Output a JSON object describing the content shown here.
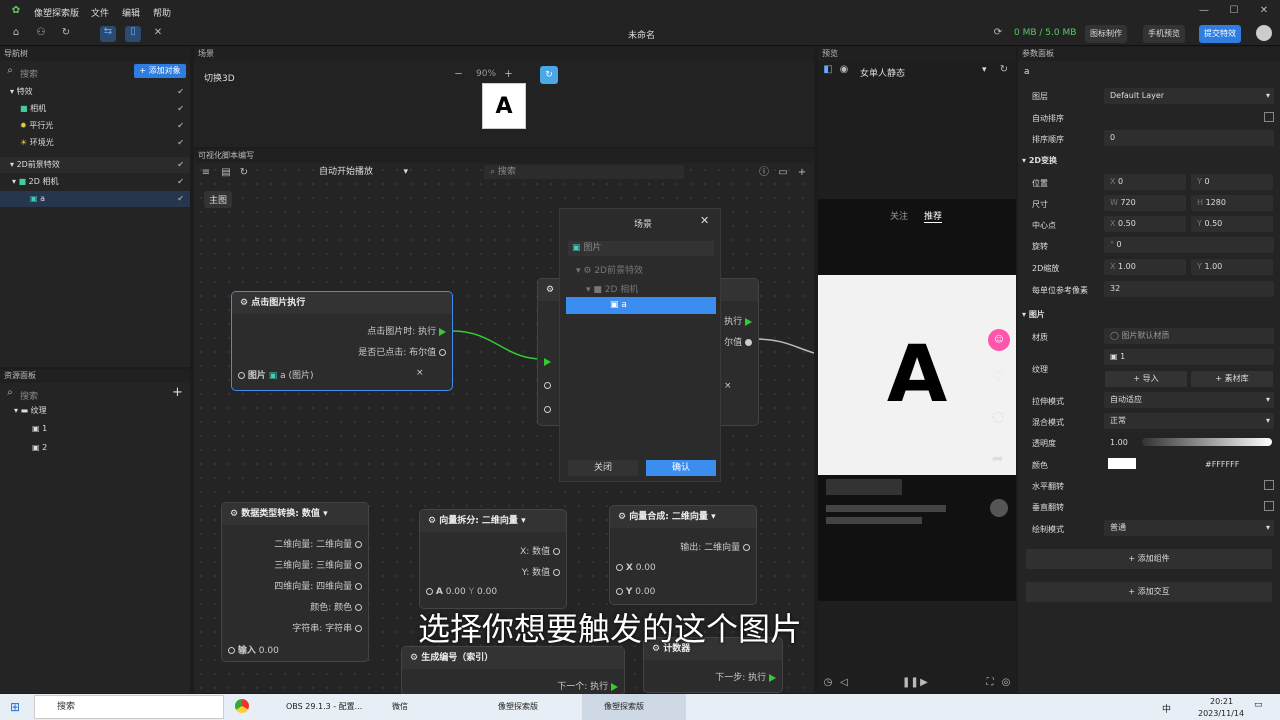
{
  "app": {
    "name": "像塑探索版",
    "menus": [
      "文件",
      "编辑",
      "帮助"
    ],
    "doc_title": "未命名"
  },
  "toolbar": {
    "storage": "0 MB / 5.0 MB",
    "icon_make": "图标制作",
    "phone_preview": "手机预览",
    "submit": "提交特效"
  },
  "nav": {
    "title": "导航树",
    "search": "搜索",
    "add": "+ 添加对象",
    "items": [
      "特效",
      "相机",
      "平行光",
      "环境光",
      "2D前景特效",
      "2D 相机",
      "a"
    ]
  },
  "scene": {
    "title": "场景",
    "switch3d": "切换3D",
    "zoom": "90%"
  },
  "script": {
    "title": "可视化脚本编写",
    "auto": "自动开始播放",
    "search": "搜索",
    "main_tab": "主图"
  },
  "node_click": {
    "title": "点击图片执行",
    "out1": "点击图片时: 执行",
    "out2": "是否已点击: 布尔值",
    "in_label": "图片",
    "in_value": "a (图片)"
  },
  "node_dt": {
    "title": "数据类型转换: 数值 ▾",
    "rows": [
      "二维向量: 二维向量",
      "三维向量: 三维向量",
      "四维向量: 四维向量",
      "颜色: 颜色",
      "字符串: 字符串"
    ],
    "input": "输入",
    "input_val": "0.00"
  },
  "node_vs": {
    "title": "向量拆分: 二维向量 ▾",
    "x": "X: 数值",
    "y": "Y: 数值",
    "a": "A",
    "av": "0.00",
    "yv": "0.00"
  },
  "node_vc": {
    "title": "向量合成: 二维向量 ▾",
    "out": "输出: 二维向量",
    "x": "X",
    "xv": "0.00",
    "y": "Y",
    "yv": "0.00"
  },
  "node_gen": {
    "title": "生成编号（索引）",
    "next": "下一个: 执行"
  },
  "node_cnt": {
    "title": "计数器",
    "next": "下一步: 执行"
  },
  "node_partial": {
    "exec": "执行",
    "val": "尔值"
  },
  "dialog": {
    "title": "场景",
    "filter": "图片",
    "tree": [
      "2D前景特效",
      "2D 相机",
      "a"
    ],
    "close": "关闭",
    "confirm": "确认"
  },
  "assets": {
    "title": "资源面板",
    "search": "搜索",
    "folder": "纹理",
    "items": [
      "1",
      "2"
    ]
  },
  "preview": {
    "title": "预览",
    "template": "女单人静态",
    "follow": "关注",
    "recommend": "推荐",
    "letter": "A"
  },
  "props": {
    "title": "参数面板",
    "name": "a",
    "layer_label": "图层",
    "layer": "Default Layer",
    "auto_sort": "自动排序",
    "sort_order": "排序顺序",
    "sort_val": "0",
    "t2d": "2D变换",
    "pos": "位置",
    "px": "0",
    "py": "0",
    "size": "尺寸",
    "w": "720",
    "h": "1280",
    "center": "中心点",
    "cx": "0.50",
    "cy": "0.50",
    "rot": "旋转",
    "rv": "0",
    "scale": "2D缩放",
    "sx": "1.00",
    "sy": "1.00",
    "ppu": "每单位参考像素",
    "ppuv": "32",
    "image": "图片",
    "material": "材质",
    "material_val": "图片默认材质",
    "texture": "纹理",
    "texture_val": "1",
    "import": "+ 导入",
    "library": "+ 素材库",
    "stretch": "拉伸模式",
    "stretch_val": "自动适应",
    "blend": "混合模式",
    "blend_val": "正常",
    "opacity": "透明度",
    "opacity_val": "1.00",
    "color": "颜色",
    "color_val": "#FFFFFF",
    "hflip": "水平翻转",
    "vflip": "垂直翻转",
    "draw": "绘制模式",
    "draw_val": "普通",
    "add_comp": "+ 添加组件",
    "add_inter": "+ 添加交互"
  },
  "subtitle": "选择你想要触发的这个图片",
  "taskbar": {
    "search": "搜索",
    "obs": "OBS 29.1.3 - 配置...",
    "wechat": "微信",
    "app1": "像塑探索版",
    "app2": "像塑探索版",
    "ime": "中",
    "time": "20:21",
    "date": "2023/11/14"
  },
  "colors": {
    "accent": "#2f7de1",
    "exec": "#33cc33"
  }
}
